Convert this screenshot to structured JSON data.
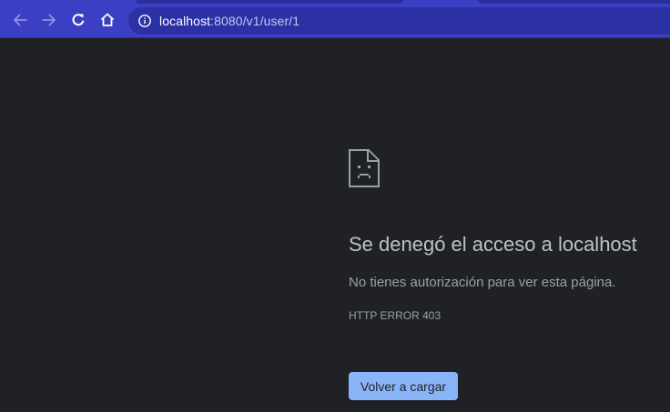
{
  "browser": {
    "url_host": "localhost",
    "url_path": ":8080/v1/user/1",
    "icons": {
      "back": "arrow-left-icon",
      "forward": "arrow-right-icon",
      "reload": "reload-icon",
      "home": "home-icon",
      "site_info": "info-icon"
    },
    "accent_color": "#3b3fc4"
  },
  "error_page": {
    "icon": "sad-document-icon",
    "title": "Se denegó el acceso a localhost",
    "description": "No tienes autorización para ver esta página.",
    "error_code": "HTTP ERROR 403",
    "reload_label": "Volver a cargar",
    "button_color": "#8ab4f8",
    "background_color": "#202124"
  }
}
